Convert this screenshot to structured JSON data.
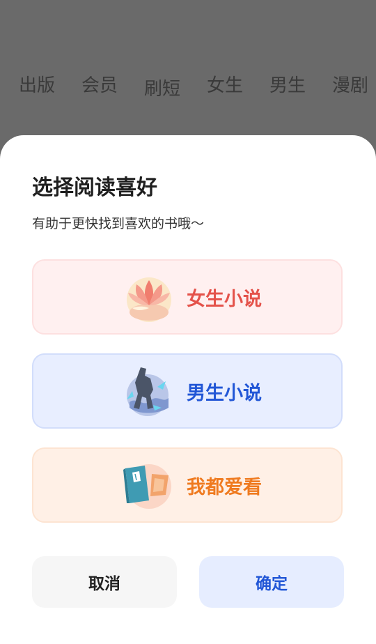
{
  "tabs": [
    "出版",
    "会员",
    "刷短",
    "女生",
    "男生",
    "漫剧"
  ],
  "dialog": {
    "title": "选择阅读喜好",
    "subtitle": "有助于更快找到喜欢的书哦～",
    "options": [
      {
        "label": "女生小说",
        "icon": "lotus-icon",
        "color": "#e4524a"
      },
      {
        "label": "男生小说",
        "icon": "warrior-icon",
        "color": "#2156d6"
      },
      {
        "label": "我都爱看",
        "icon": "book-icon",
        "color": "#ef7a1f"
      }
    ],
    "cancel_label": "取消",
    "confirm_label": "确定"
  }
}
